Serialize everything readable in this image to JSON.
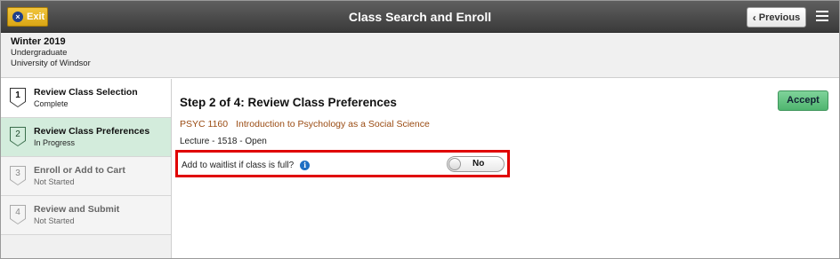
{
  "banner": {
    "exit_label": "Exit",
    "title": "Class Search and Enroll",
    "previous_label": "Previous"
  },
  "term": {
    "name": "Winter 2019",
    "career": "Undergraduate",
    "institution": "University of Windsor"
  },
  "steps": [
    {
      "number": "1",
      "label": "Review Class Selection",
      "status": "Complete"
    },
    {
      "number": "2",
      "label": "Review Class Preferences",
      "status": "In Progress"
    },
    {
      "number": "3",
      "label": "Enroll or Add to Cart",
      "status": "Not Started"
    },
    {
      "number": "4",
      "label": "Review and Submit",
      "status": "Not Started"
    }
  ],
  "main": {
    "step_title": "Step 2 of 4: Review Class Preferences",
    "accept_label": "Accept",
    "course_code": "PSYC 1160",
    "course_title": "Introduction to Psychology as a Social Science",
    "section_info": "Lecture - 1518 - Open",
    "waitlist_label": "Add to waitlist if class is full?",
    "waitlist_value": "No"
  },
  "colors": {
    "banner": "#4a4a4a",
    "exit_button": "#e8b82a",
    "accept_button": "#5cbf7a",
    "active_step": "#d3ecdc",
    "course_link": "#9a4b12",
    "highlight_border": "#e00000"
  },
  "icons": {
    "exit": "close-circle-icon",
    "previous": "chevron-left-icon",
    "menu": "hamburger-menu-icon",
    "info": "info-icon"
  }
}
